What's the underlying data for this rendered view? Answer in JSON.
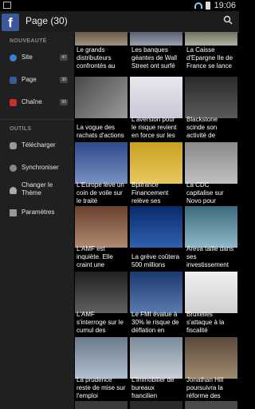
{
  "status_bar": {
    "time": "19:06"
  },
  "app_bar": {
    "title": "Page (30)",
    "logo": "f"
  },
  "sidebar": {
    "section1": "NOUVEAUTÉ",
    "items1": [
      {
        "label": "Site",
        "count": "47"
      },
      {
        "label": "Page",
        "count": "30"
      },
      {
        "label": "Chaîne",
        "count": "50"
      }
    ],
    "section2": "OUTILS",
    "items2": [
      {
        "label": "Télécharger"
      },
      {
        "label": "Synchroniser"
      },
      {
        "label_line1": "Changer le",
        "label_line2": "Thème"
      },
      {
        "label": "Paramètres"
      }
    ]
  },
  "articles": [
    "Le grands distributeurs confrontés au",
    "Les banques géantes de Wall Street ont surfé",
    "La Caisse d'Epargne Ile de France se lance",
    "La vogue des rachats d'actions",
    "L'aversion pour le risque revient en force sur les",
    "Blackstone scinde son activité de",
    "L'Europe lève un coin de voile sur le traité",
    "Bpifrance Financement relève ses",
    "La CDC capitalise sur Novo pour",
    "L'AMF est inquiète. Elle craint une",
    "La grève coûtera 500 millions",
    "Areva taille dans ses investissement",
    "L'AMF s'interroge sur le cumul des",
    "Le FMI évalue à 30% le risque de déflation en",
    "Bruxelles s'attaque à la fiscalité",
    "La prudence reste de mise sur l'emploi",
    "L'immobilier de bureaux francilien",
    "Jonathan Hill poursuivra la réforme des"
  ]
}
